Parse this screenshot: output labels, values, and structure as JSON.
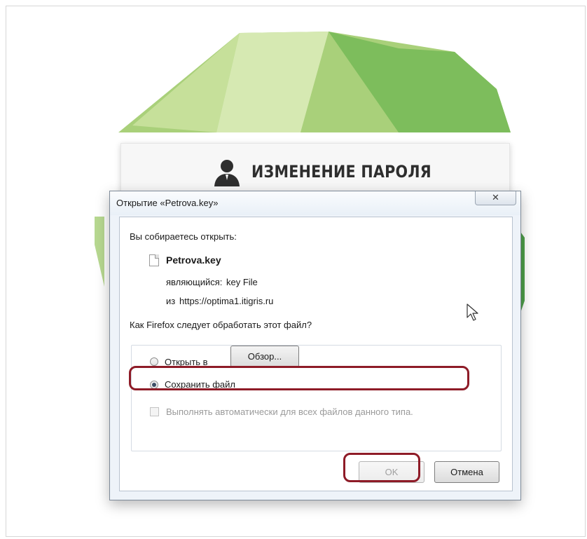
{
  "backdrop": {
    "heading": "ИЗМЕНЕНИЕ ПАРОЛЯ",
    "brand_color": "#6fb04d"
  },
  "dialog": {
    "title": "Открытие «Petrova.key»",
    "close_symbol": "✕",
    "prompt": "Вы собираетесь открыть:",
    "file_name": "Petrova.key",
    "type_label": "являющийся:",
    "type_value": "key File",
    "from_label": "из",
    "from_value": "https://optima1.itigris.ru",
    "question": "Как Firefox следует обработать этот файл?",
    "open_with_label": "Открыть в",
    "open_with_checked": false,
    "browse_label": "Обзор...",
    "save_file_label": "Сохранить файл",
    "save_file_checked": true,
    "auto_label": "Выполнять автоматически для всех файлов данного типа.",
    "auto_checked": false,
    "auto_enabled": false,
    "ok_label": "OK",
    "ok_enabled": false,
    "cancel_label": "Отмена"
  },
  "annotation_color": "#8e1b27",
  "icons": {
    "user": "user-silhouette-icon",
    "file": "file-icon",
    "close": "close-icon",
    "cursor": "mouse-cursor-icon"
  }
}
